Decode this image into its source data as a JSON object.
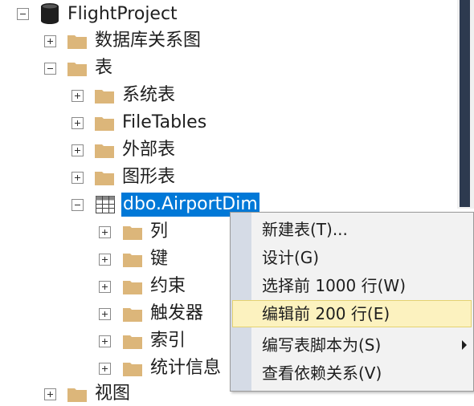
{
  "tree": {
    "root": {
      "label": "FlightProject",
      "icon": "database-icon"
    },
    "items": [
      {
        "label": "数据库关系图",
        "state": "collapsed"
      },
      {
        "label": "表",
        "state": "expanded"
      },
      {
        "label": "系统表",
        "state": "collapsed"
      },
      {
        "label": "FileTables",
        "state": "collapsed"
      },
      {
        "label": "外部表",
        "state": "collapsed"
      },
      {
        "label": "图形表",
        "state": "collapsed"
      },
      {
        "label": "dbo.AirportDim",
        "state": "expanded",
        "selected": true
      },
      {
        "label": "列",
        "state": "collapsed"
      },
      {
        "label": "键",
        "state": "collapsed"
      },
      {
        "label": "约束",
        "state": "collapsed"
      },
      {
        "label": "触发器",
        "state": "collapsed"
      },
      {
        "label": "索引",
        "state": "collapsed"
      },
      {
        "label": "统计信息",
        "state": "collapsed"
      },
      {
        "label": "视图",
        "state": "collapsed"
      }
    ]
  },
  "context_menu": {
    "items": [
      {
        "label": "新建表(T)..."
      },
      {
        "label": "设计(G)"
      },
      {
        "label": "选择前 1000 行(W)"
      },
      {
        "label": "编辑前 200 行(E)",
        "highlighted": true
      },
      {
        "label": "编写表脚本为(S)",
        "has_submenu": true
      },
      {
        "label": "查看依赖关系(V)"
      }
    ]
  },
  "colors": {
    "selection": "#0078d7",
    "menu_highlight": "#fcf2bf",
    "folder": "#dcb67a",
    "scrollbar_thumb": "#2d3a4f"
  }
}
